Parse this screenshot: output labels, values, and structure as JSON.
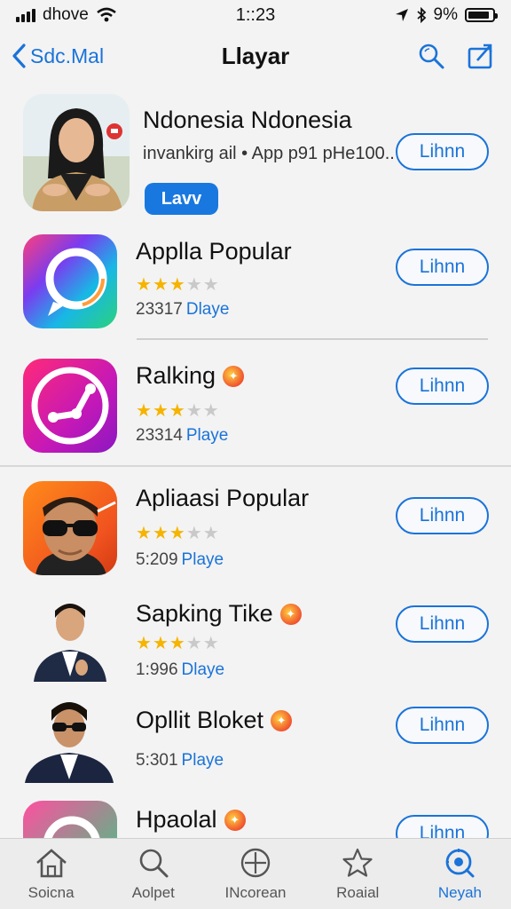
{
  "status": {
    "carrier": "dhove",
    "time": "1::23",
    "battery_text": "9%",
    "battery_level": 0.9
  },
  "nav": {
    "back_label": "Sdc.Mal",
    "title": "Llayar"
  },
  "featured": {
    "title": "Ndonesia Ndonesia",
    "subtitle": "invankirg ail • App p91 pHe100..",
    "pill_label": "Lavv",
    "button_label": "Lihnn"
  },
  "apps": [
    {
      "title": "Applla Popular",
      "rating": 3,
      "count": "23317",
      "link": "Dlaye",
      "button_label": "Lihnn",
      "badge": false
    },
    {
      "title": "Ralking",
      "rating": 3,
      "count": "23314",
      "link": "Playe",
      "button_label": "Lihnn",
      "badge": true
    },
    {
      "title": "Apliaasi Popular",
      "rating": 3,
      "count": "5:209",
      "link": "Playe",
      "button_label": "Lihnn",
      "badge": false
    },
    {
      "title": "Sapking Tike",
      "rating": 3,
      "count": "1:996",
      "link": "Dlaye",
      "button_label": "Lihnn",
      "badge": true
    },
    {
      "title": "Opllit Bloket",
      "rating": 0,
      "count": "5:301",
      "link": "Playe",
      "button_label": "Lihnn",
      "badge": true
    },
    {
      "title": "Hpaolal",
      "rating": 0,
      "count": "",
      "link": "",
      "button_label": "Lihnn",
      "badge": true
    }
  ],
  "tabs": [
    {
      "label": "Soicna",
      "icon": "home-icon",
      "active": false
    },
    {
      "label": "Aolpet",
      "icon": "search-icon",
      "active": false
    },
    {
      "label": "INcorean",
      "icon": "plus-circle-icon",
      "active": false
    },
    {
      "label": "Roaial",
      "icon": "star-icon",
      "active": false
    },
    {
      "label": "Neyah",
      "icon": "target-search-icon",
      "active": true
    }
  ],
  "colors": {
    "accent": "#1a73d9",
    "star": "#f5b400",
    "background": "#f3f3f3"
  }
}
